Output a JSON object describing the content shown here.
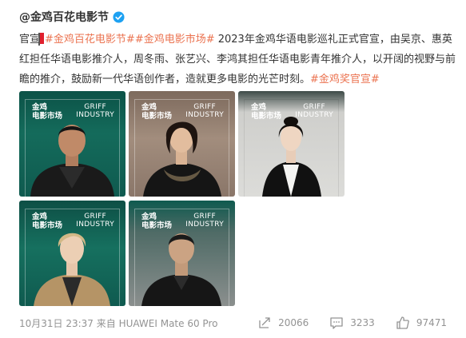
{
  "post": {
    "username": "@金鸡百花电影节",
    "text_prefix": "官宣",
    "tag1": "#金鸡百花电影节#",
    "tag2": "#金鸡电影市场#",
    "text_body": " 2023年金鸡华语电影巡礼正式官宣，由吴京、惠英红担任华语电影推介人，周冬雨、张艺兴、李鸿其担任华语电影青年推介人，以开阔的视野与前瞻的推介，鼓励新一代华语创作者，造就更多电影的光芒时刻。",
    "tag3": "#金鸡奖官宣#"
  },
  "photos": [
    {
      "label_cn_1": "金鸡",
      "label_cn_2": "电影市场",
      "label_en_1": "GRIFF",
      "label_en_2": "INDUSTRY",
      "theme": "teal-dark"
    },
    {
      "label_cn_1": "金鸡",
      "label_cn_2": "电影市场",
      "label_en_1": "GRIFF",
      "label_en_2": "INDUSTRY",
      "theme": "tan"
    },
    {
      "label_cn_1": "金鸡",
      "label_cn_2": "电影市场",
      "label_en_1": "GRIFF",
      "label_en_2": "INDUSTRY",
      "theme": "light"
    },
    {
      "label_cn_1": "金鸡",
      "label_cn_2": "电影市场",
      "label_en_1": "GRIFF",
      "label_en_2": "INDUSTRY",
      "theme": "teal-dark"
    },
    {
      "label_cn_1": "金鸡",
      "label_cn_2": "电影市场",
      "label_en_1": "GRIFF",
      "label_en_2": "INDUSTRY",
      "theme": "teal-dark"
    }
  ],
  "footer": {
    "meta": "10月31日 23:37 来自 HUAWEI Mate 60 Pro",
    "reposts": "20066",
    "comments": "3233",
    "likes": "97471"
  },
  "icons": {
    "verify": "verified-badge-icon",
    "repost": "repost-icon",
    "comment": "comment-icon",
    "like": "thumbs-up-icon"
  },
  "colors": {
    "tag": "#eb7350",
    "verify": "#1da1f2",
    "teal": "#0f5a4f",
    "tan": "#9a8575"
  }
}
